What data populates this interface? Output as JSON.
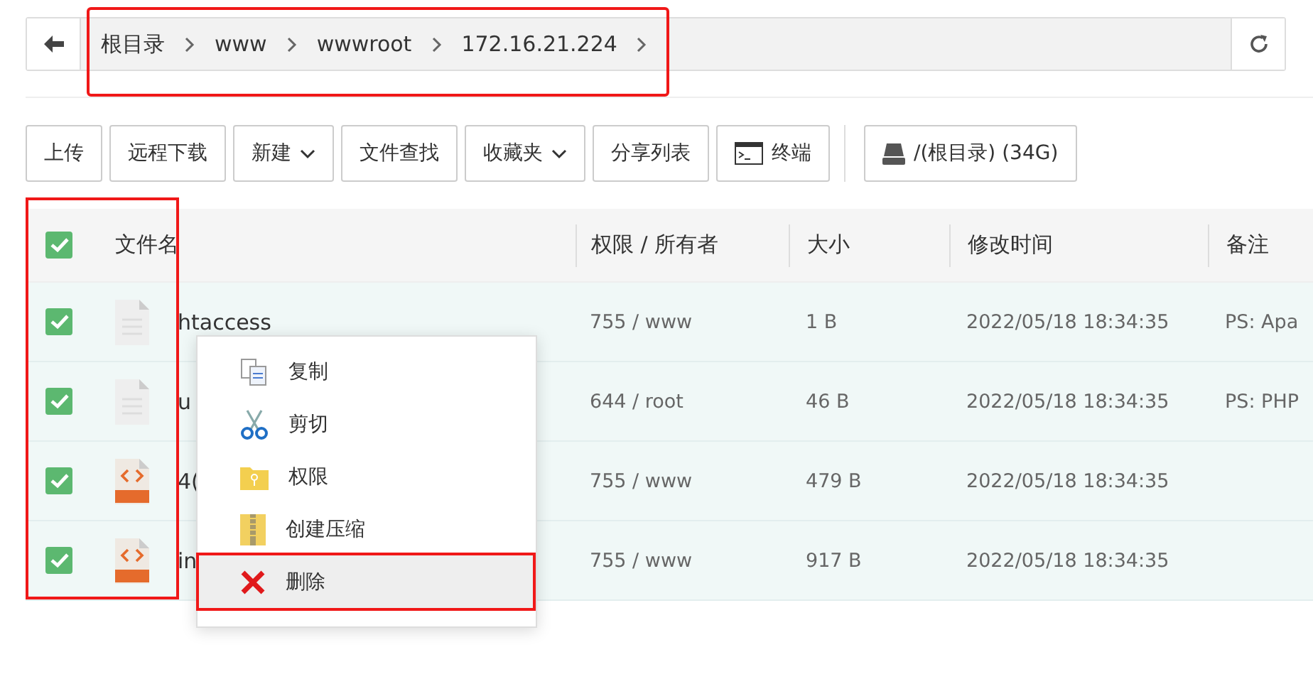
{
  "path_bar": {
    "crumbs": [
      "根目录",
      "www",
      "wwwroot",
      "172.16.21.224"
    ],
    "highlighted": true
  },
  "toolbar": [
    {
      "label": "上传",
      "kind": "plain"
    },
    {
      "label": "远程下载",
      "kind": "plain"
    },
    {
      "label": "新建",
      "kind": "dropdown"
    },
    {
      "label": "文件查找",
      "kind": "plain"
    },
    {
      "label": "收藏夹",
      "kind": "dropdown"
    },
    {
      "label": "分享列表",
      "kind": "plain"
    },
    {
      "label": "终端",
      "kind": "terminal"
    },
    {
      "label": "/(根目录) (34G)",
      "kind": "disk"
    }
  ],
  "table": {
    "select_all": {
      "checked": true
    },
    "checkbox_column_highlighted": true,
    "columns": [
      "文件名",
      "权限 / 所有者",
      "大小",
      "修改时间",
      "备注"
    ],
    "rows": [
      {
        "checked": true,
        "kind": "text",
        "name": "htaccess",
        "perm": "755 / www",
        "size": "1 B",
        "modified": "2022/05/18 18:34:35",
        "note": "PS: Apa"
      },
      {
        "checked": true,
        "kind": "text",
        "name": "u",
        "perm": "644 / root",
        "size": "46 B",
        "modified": "2022/05/18 18:34:35",
        "note": "PS: PHP"
      },
      {
        "checked": true,
        "kind": "html",
        "name": "4(",
        "perm": "755 / www",
        "size": "479 B",
        "modified": "2022/05/18 18:34:35"
      },
      {
        "checked": true,
        "kind": "html",
        "name": "in",
        "perm": "755 / www",
        "size": "917 B",
        "modified": "2022/05/18 18:34:35"
      }
    ]
  },
  "context_menu": [
    {
      "label": "复制",
      "kind": "copy",
      "highlighted": false
    },
    {
      "label": "剪切",
      "kind": "cut",
      "highlighted": false
    },
    {
      "label": "权限",
      "kind": "permission",
      "highlighted": false
    },
    {
      "label": "创建压缩",
      "kind": "zip",
      "highlighted": false
    },
    {
      "label": "删除",
      "kind": "delete",
      "highlighted": true
    }
  ]
}
